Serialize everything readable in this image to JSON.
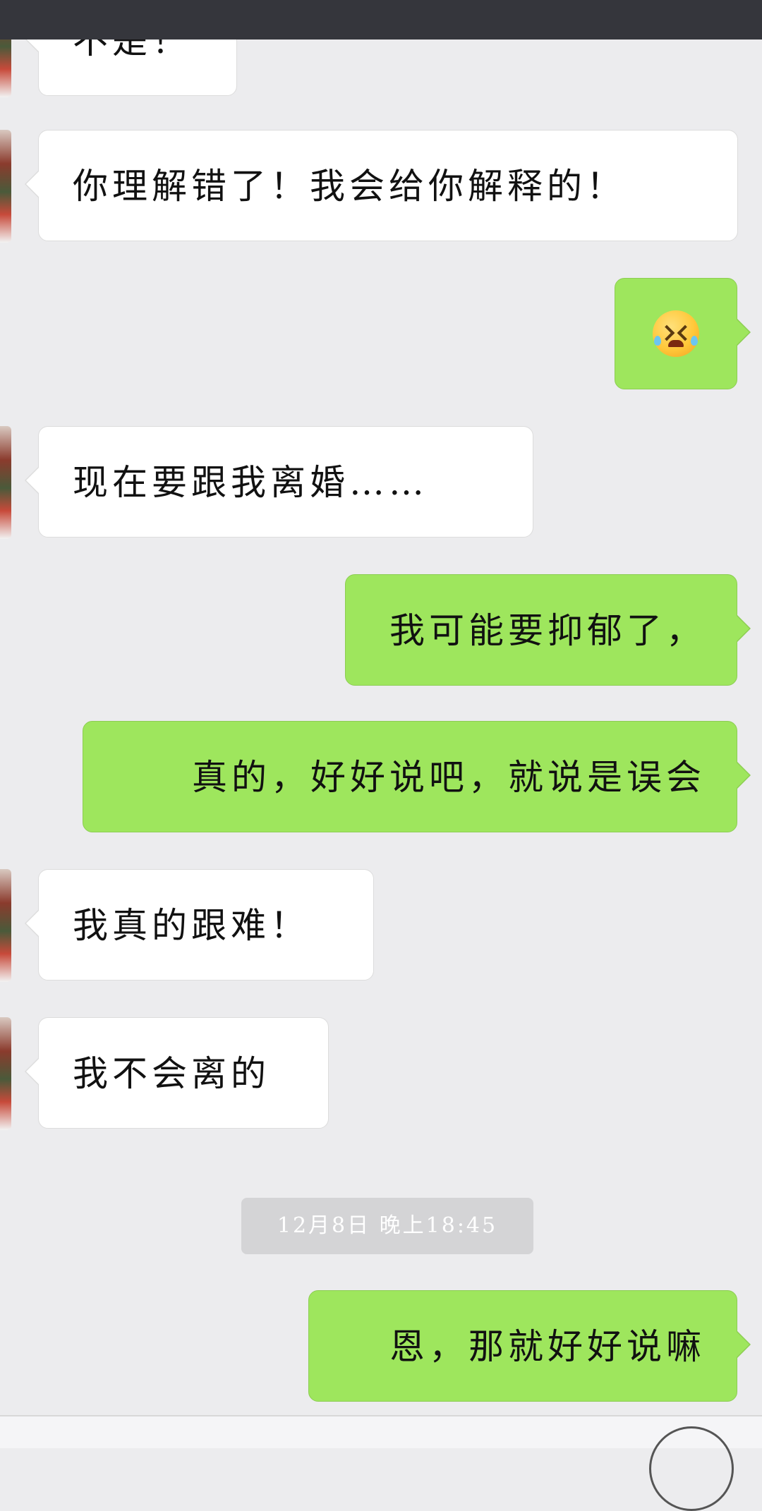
{
  "messages": [
    {
      "side": "in",
      "text": "不是！"
    },
    {
      "side": "in",
      "text": "你理解错了！我会给你解释的！"
    },
    {
      "side": "out",
      "emoji": "crying-laughing-face"
    },
    {
      "side": "in",
      "text": "现在要跟我离婚……"
    },
    {
      "side": "out",
      "text": "我可能要抑郁了，"
    },
    {
      "side": "out",
      "text": "真的，好好说吧，就说是误会"
    },
    {
      "side": "in",
      "text": "我真的跟难！"
    },
    {
      "side": "in",
      "text": "我不会离的"
    },
    {
      "side": "out",
      "text": "恩，那就好好说嘛"
    }
  ],
  "timestamp": "12月8日 晚上18:45",
  "colors": {
    "status_bar": "#35363c",
    "chat_background": "#ececee",
    "incoming_bubble": "#ffffff",
    "outgoing_bubble": "#9ee65d",
    "timestamp_background": "#d4d4d6"
  }
}
